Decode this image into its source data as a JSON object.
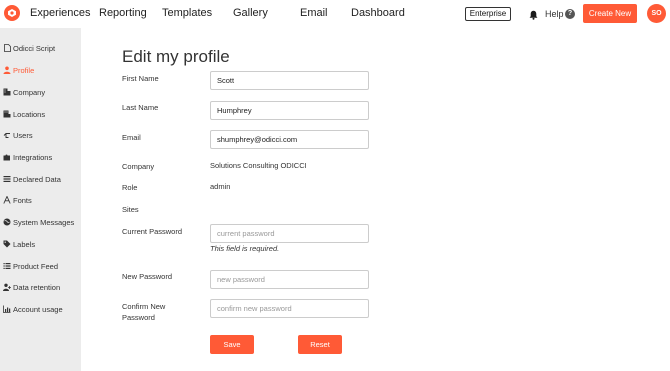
{
  "nav": {
    "items": [
      "Experiences",
      "Reporting",
      "Templates",
      "Gallery",
      "Email",
      "Dashboard"
    ],
    "plan_badge": "Enterprise",
    "help_label": "Help",
    "help_badge": "?",
    "create_new_label": "Create New",
    "avatar_initials": "SO",
    "brand_color": "#ff5a36"
  },
  "sidebar": {
    "items": [
      {
        "label": "Odicci Script",
        "icon": "document-icon"
      },
      {
        "label": "Profile",
        "icon": "user-icon",
        "active": true
      },
      {
        "label": "Company",
        "icon": "building-icon"
      },
      {
        "label": "Locations",
        "icon": "location-icon"
      },
      {
        "label": "Users",
        "icon": "users-icon"
      },
      {
        "label": "Integrations",
        "icon": "puzzle-icon"
      },
      {
        "label": "Declared Data",
        "icon": "list-icon"
      },
      {
        "label": "Fonts",
        "icon": "font-icon"
      },
      {
        "label": "System Messages",
        "icon": "globe-icon"
      },
      {
        "label": "Labels",
        "icon": "tag-icon"
      },
      {
        "label": "Product Feed",
        "icon": "feed-icon"
      },
      {
        "label": "Data retention",
        "icon": "user-plus-icon"
      },
      {
        "label": "Account usage",
        "icon": "chart-icon"
      }
    ]
  },
  "profile": {
    "title": "Edit my profile",
    "first_name_label": "First Name",
    "first_name_value": "Scott",
    "last_name_label": "Last Name",
    "last_name_value": "Humphrey",
    "email_label": "Email",
    "email_value": "shumphrey@odicci.com",
    "company_label": "Company",
    "company_value": "Solutions Consulting ODICCI",
    "role_label": "Role",
    "role_value": "admin",
    "sites_label": "Sites",
    "current_password_label": "Current Password",
    "current_password_placeholder": "current password",
    "current_password_error": "This field is required.",
    "new_password_label": "New Password",
    "new_password_placeholder": "new password",
    "confirm_password_label": "Confirm New Password",
    "confirm_password_placeholder": "confirm new password",
    "save_label": "Save",
    "reset_label": "Reset"
  }
}
